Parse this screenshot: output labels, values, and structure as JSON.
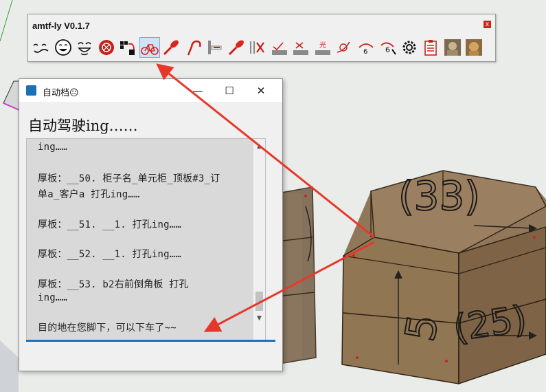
{
  "toolbar": {
    "title": "amtf-ly V0.1.7",
    "close_label": "x",
    "tools": [
      {
        "name": "tool-wavy-face-icon"
      },
      {
        "name": "tool-smile-icon"
      },
      {
        "name": "tool-laugh-icon"
      },
      {
        "name": "tool-red-badge-icon"
      },
      {
        "name": "tool-squares-icon"
      },
      {
        "name": "tool-bike-icon",
        "active": true
      },
      {
        "name": "tool-drill-icon"
      },
      {
        "name": "tool-hook-icon"
      },
      {
        "name": "tool-panel-icon"
      },
      {
        "name": "tool-drill2-icon"
      },
      {
        "name": "tool-cut-icon"
      },
      {
        "name": "tool-tray1-icon"
      },
      {
        "name": "tool-tray2-icon"
      },
      {
        "name": "tool-tray3-icon"
      },
      {
        "name": "tool-swirl-icon"
      },
      {
        "name": "tool-rotate6-icon"
      },
      {
        "name": "tool-probe6-icon"
      },
      {
        "name": "tool-gear-icon"
      },
      {
        "name": "tool-clipboard-icon"
      },
      {
        "name": "tool-photo1-icon"
      },
      {
        "name": "tool-photo2-icon"
      }
    ]
  },
  "dialog": {
    "title": "自动档😐",
    "heading": "自动驾驶ing……",
    "minimize": "—",
    "maximize": "☐",
    "close": "✕",
    "log_lines": [
      "ing……",
      "",
      "厚板：__50. 柜子名_单元柜_顶板#3_订",
      "单a_客户a 打孔ing……",
      "",
      "厚板：__51. __1. 打孔ing……",
      "",
      "厚板：__52. __1. 打孔ing……",
      "",
      "厚板：__53. b2右前倒角板 打孔",
      "ing……",
      "",
      "目的地在您脚下，可以下车了~~"
    ]
  },
  "scene": {
    "label_33": "(33)",
    "label_25": "(25)",
    "label_5": "5"
  },
  "colors": {
    "arrow": "#e8372a",
    "wood": "#8a6b48",
    "accent": "#1e6fc0"
  }
}
